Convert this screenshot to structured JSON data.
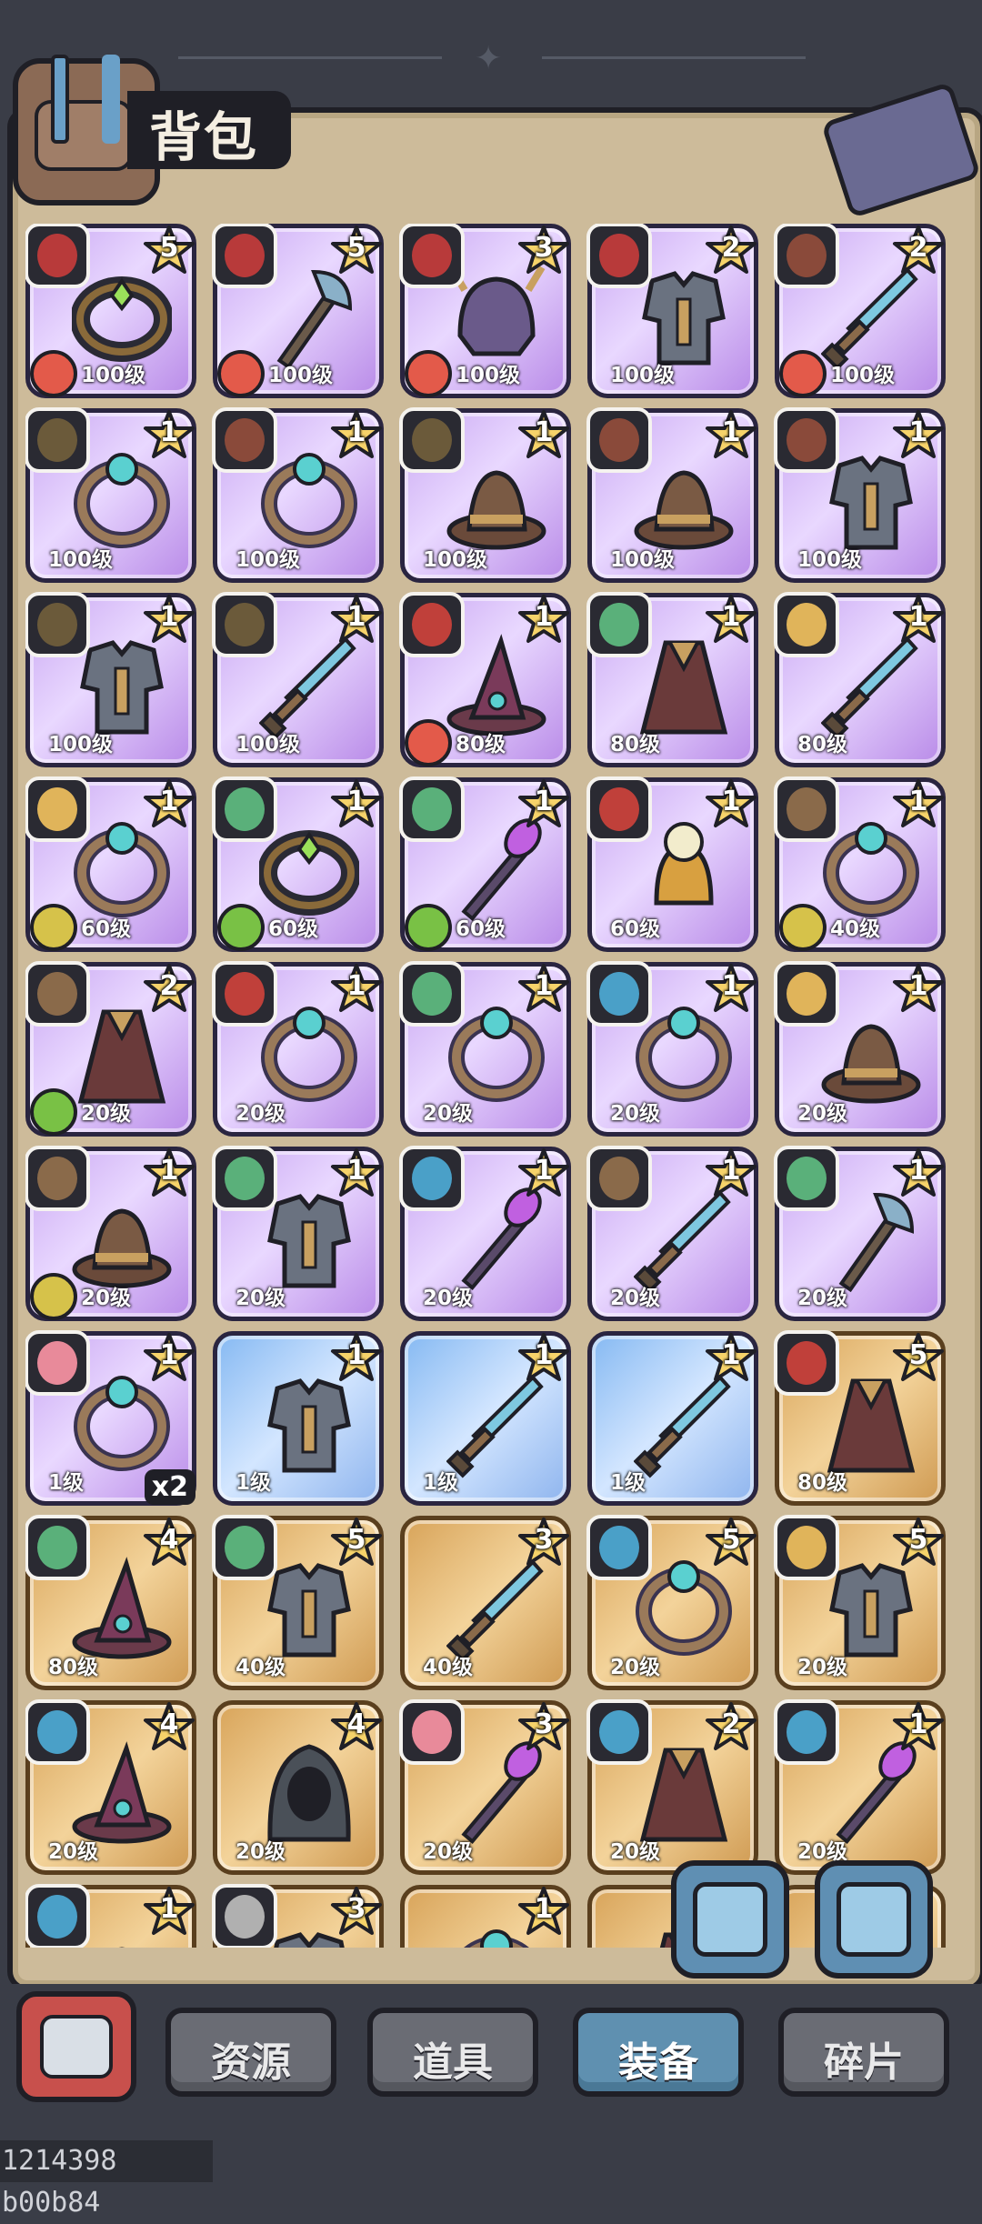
{
  "header": {
    "title": "背包"
  },
  "tabs": [
    {
      "label": "资源",
      "active": false
    },
    {
      "label": "道具",
      "active": false
    },
    {
      "label": "装备",
      "active": true
    },
    {
      "label": "碎片",
      "active": false
    }
  ],
  "debug_text": "1214398 b00b84",
  "colors": {
    "frame": "#1f1f26",
    "panel": "#cdbb9a",
    "active_tab": "#5f90b0",
    "inactive_tab": "#6a6c74",
    "back_button": "#c8504c"
  },
  "rows": [
    [
      {
        "rarity": "purple",
        "stars": "5",
        "level": "100级",
        "element": "fire",
        "hero": "#b83a3a",
        "item": "bracer-icon"
      },
      {
        "rarity": "purple",
        "stars": "5",
        "level": "100级",
        "element": "fire",
        "hero": "#b83a3a",
        "item": "axe-icon"
      },
      {
        "rarity": "purple",
        "stars": "3",
        "level": "100级",
        "element": "fire",
        "hero": "#b83a3a",
        "item": "helmet-icon"
      },
      {
        "rarity": "purple",
        "stars": "2",
        "level": "100级",
        "element": "",
        "hero": "#b83a3a",
        "item": "armor-icon"
      },
      {
        "rarity": "purple",
        "stars": "2",
        "level": "100级",
        "element": "fire",
        "hero": "#8a4a3a",
        "item": "sword-icon"
      }
    ],
    [
      {
        "rarity": "purple",
        "stars": "1",
        "level": "100级",
        "element": "",
        "hero": "#6b5a3a",
        "item": "ring-icon"
      },
      {
        "rarity": "purple",
        "stars": "1",
        "level": "100级",
        "element": "",
        "hero": "#8a4a3a",
        "item": "ring-icon"
      },
      {
        "rarity": "purple",
        "stars": "1",
        "level": "100级",
        "element": "",
        "hero": "#6b5a3a",
        "item": "hat-icon"
      },
      {
        "rarity": "purple",
        "stars": "1",
        "level": "100级",
        "element": "",
        "hero": "#8a4a3a",
        "item": "hat-icon"
      },
      {
        "rarity": "purple",
        "stars": "1",
        "level": "100级",
        "element": "",
        "hero": "#8a4a3a",
        "item": "armor-icon"
      }
    ],
    [
      {
        "rarity": "purple",
        "stars": "1",
        "level": "100级",
        "element": "",
        "hero": "#6b5a3a",
        "item": "armor-icon"
      },
      {
        "rarity": "purple",
        "stars": "1",
        "level": "100级",
        "element": "",
        "hero": "#6b5a3a",
        "item": "sword-icon"
      },
      {
        "rarity": "purple",
        "stars": "1",
        "level": "80级",
        "element": "fire",
        "hero": "#c0403a",
        "item": "witch-hat-icon"
      },
      {
        "rarity": "purple",
        "stars": "1",
        "level": "80级",
        "element": "",
        "hero": "#5ab07a",
        "item": "cloak-icon"
      },
      {
        "rarity": "purple",
        "stars": "1",
        "level": "80级",
        "element": "",
        "hero": "#e0b45a",
        "item": "sword-icon"
      }
    ],
    [
      {
        "rarity": "purple",
        "stars": "1",
        "level": "60级",
        "element": "earth",
        "hero": "#e0b45a",
        "item": "ring-icon"
      },
      {
        "rarity": "purple",
        "stars": "1",
        "level": "60级",
        "element": "wind",
        "hero": "#5ab07a",
        "item": "bracer-icon"
      },
      {
        "rarity": "purple",
        "stars": "1",
        "level": "60级",
        "element": "wind",
        "hero": "#5ab07a",
        "item": "staff-icon"
      },
      {
        "rarity": "purple",
        "stars": "1",
        "level": "60级",
        "element": "",
        "hero": "#c0403a",
        "item": "bell-icon"
      },
      {
        "rarity": "purple",
        "stars": "1",
        "level": "40级",
        "element": "earth",
        "hero": "#8a6a4a",
        "item": "ring-icon"
      }
    ],
    [
      {
        "rarity": "purple",
        "stars": "2",
        "level": "20级",
        "element": "wind",
        "hero": "#8a6a4a",
        "item": "cloak-icon"
      },
      {
        "rarity": "purple",
        "stars": "1",
        "level": "20级",
        "element": "",
        "hero": "#c0403a",
        "item": "ring-icon"
      },
      {
        "rarity": "purple",
        "stars": "1",
        "level": "20级",
        "element": "",
        "hero": "#5ab07a",
        "item": "ring-icon"
      },
      {
        "rarity": "purple",
        "stars": "1",
        "level": "20级",
        "element": "",
        "hero": "#4aa0c8",
        "item": "ring-icon"
      },
      {
        "rarity": "purple",
        "stars": "1",
        "level": "20级",
        "element": "",
        "hero": "#e0b45a",
        "item": "hat-icon"
      }
    ],
    [
      {
        "rarity": "purple",
        "stars": "1",
        "level": "20级",
        "element": "earth",
        "hero": "#8a6a4a",
        "item": "hat-icon"
      },
      {
        "rarity": "purple",
        "stars": "1",
        "level": "20级",
        "element": "",
        "hero": "#5ab07a",
        "item": "armor-icon"
      },
      {
        "rarity": "purple",
        "stars": "1",
        "level": "20级",
        "element": "",
        "hero": "#4aa0c8",
        "item": "staff-icon"
      },
      {
        "rarity": "purple",
        "stars": "1",
        "level": "20级",
        "element": "",
        "hero": "#8a6a4a",
        "item": "sword-icon"
      },
      {
        "rarity": "purple",
        "stars": "1",
        "level": "20级",
        "element": "",
        "hero": "#5ab07a",
        "item": "axe-icon"
      }
    ],
    [
      {
        "rarity": "purple",
        "stars": "1",
        "level": "1级",
        "element": "",
        "hero": "#e88a9a",
        "item": "ring-icon",
        "count": "x2"
      },
      {
        "rarity": "blue",
        "stars": "1",
        "level": "1级",
        "element": "",
        "hero": "",
        "item": "armor-icon"
      },
      {
        "rarity": "blue",
        "stars": "1",
        "level": "1级",
        "element": "",
        "hero": "",
        "item": "sword-icon"
      },
      {
        "rarity": "blue",
        "stars": "1",
        "level": "1级",
        "element": "",
        "hero": "",
        "item": "sword-icon"
      },
      {
        "rarity": "gold",
        "stars": "5",
        "level": "80级",
        "element": "",
        "hero": "#c0403a",
        "item": "cloak-icon"
      }
    ],
    [
      {
        "rarity": "gold",
        "stars": "4",
        "level": "80级",
        "element": "",
        "hero": "#5ab07a",
        "item": "witch-hat-icon"
      },
      {
        "rarity": "gold",
        "stars": "5",
        "level": "40级",
        "element": "",
        "hero": "#5ab07a",
        "item": "armor-icon"
      },
      {
        "rarity": "gold",
        "stars": "3",
        "level": "40级",
        "element": "",
        "hero": "",
        "item": "sword-icon"
      },
      {
        "rarity": "gold",
        "stars": "5",
        "level": "20级",
        "element": "",
        "hero": "#4aa0c8",
        "item": "ring-icon"
      },
      {
        "rarity": "gold",
        "stars": "5",
        "level": "20级",
        "element": "",
        "hero": "#e0b45a",
        "item": "armor-icon"
      }
    ],
    [
      {
        "rarity": "gold",
        "stars": "4",
        "level": "20级",
        "element": "",
        "hero": "#4aa0c8",
        "item": "witch-hat-icon"
      },
      {
        "rarity": "gold",
        "stars": "4",
        "level": "20级",
        "element": "",
        "hero": "",
        "item": "hood-icon"
      },
      {
        "rarity": "gold",
        "stars": "3",
        "level": "20级",
        "element": "",
        "hero": "#e88a9a",
        "item": "staff-icon"
      },
      {
        "rarity": "gold",
        "stars": "2",
        "level": "20级",
        "element": "",
        "hero": "#4aa0c8",
        "item": "cloak-icon"
      },
      {
        "rarity": "gold",
        "stars": "1",
        "level": "20级",
        "element": "",
        "hero": "#4aa0c8",
        "item": "staff-icon"
      }
    ],
    [
      {
        "rarity": "gold",
        "stars": "1",
        "level": "",
        "element": "",
        "hero": "#4aa0c8",
        "item": "hat-icon"
      },
      {
        "rarity": "gold",
        "stars": "3",
        "level": "",
        "element": "",
        "hero": "#b0b0b0",
        "item": "armor-icon"
      },
      {
        "rarity": "gold",
        "stars": "1",
        "level": "",
        "element": "",
        "hero": "",
        "item": "ring-icon"
      },
      {
        "rarity": "gold",
        "stars": "",
        "level": "",
        "element": "",
        "hero": "",
        "item": "cloak-icon"
      },
      {
        "rarity": "gold",
        "stars": "",
        "level": "",
        "element": "",
        "hero": "",
        "item": "armor-icon"
      }
    ]
  ],
  "action_buttons": [
    {
      "icon": "save-disk-icon"
    },
    {
      "icon": "anvil-icon"
    }
  ]
}
